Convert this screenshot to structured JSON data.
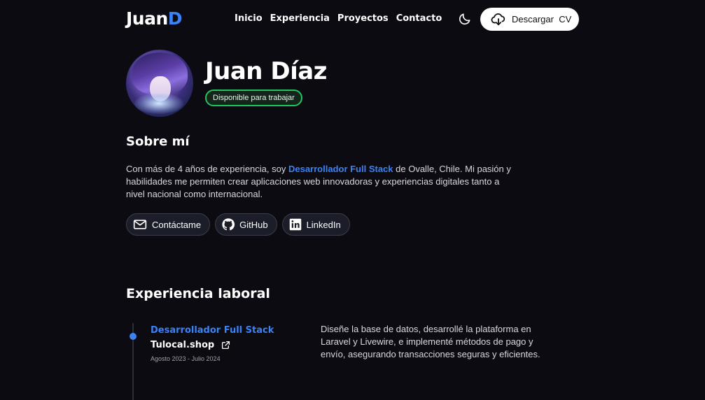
{
  "header": {
    "logo_main": "Juan",
    "logo_accent": "D",
    "nav": [
      {
        "label": "Inicio"
      },
      {
        "label": "Experiencia"
      },
      {
        "label": "Proyectos"
      },
      {
        "label": "Contacto"
      }
    ],
    "theme_icon": "moon-icon",
    "cv_button": {
      "label": "Descargar  CV",
      "icon": "cloud-download-icon"
    }
  },
  "profile": {
    "name": "Juan Díaz",
    "status_badge": "Disponible para trabajar",
    "avatar_icon": "avatar-illustration"
  },
  "about": {
    "title": "Sobre mí",
    "text_before": "Con más de 4 años de experiencia, soy ",
    "highlight": "Desarrollador Full Stack",
    "text_after": " de Ovalle, Chile. Mi pasión y habilidades me permiten crear aplicaciones web innovadoras y experiencias digitales tanto a nivel nacional como internacional.",
    "socials": [
      {
        "label": "Contáctame",
        "icon": "mail-icon"
      },
      {
        "label": "GitHub",
        "icon": "github-icon"
      },
      {
        "label": "LinkedIn",
        "icon": "linkedin-icon"
      }
    ]
  },
  "experience": {
    "title": "Experiencia laboral",
    "jobs": [
      {
        "role": "Desarrollador Full Stack",
        "company": "Tulocal.shop",
        "dates": "Agosto 2023 - Julio 2024",
        "description": "Diseñe la base de datos, desarrollé la plataforma en Laravel y Livewire, e implementé métodos de pago y envío, asegurando transacciones seguras y eficientes."
      }
    ]
  },
  "colors": {
    "accent": "#3b82f6",
    "background": "#0c0b12",
    "badge_border": "#22c55e"
  }
}
